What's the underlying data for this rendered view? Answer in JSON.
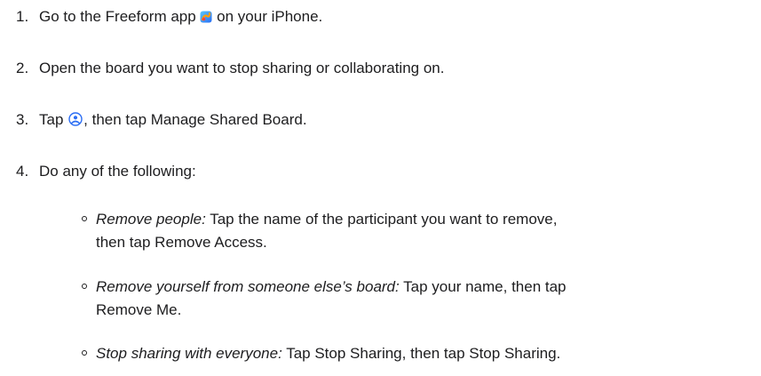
{
  "steps": [
    {
      "num": "1.",
      "before": "Go to the Freeform app",
      "icon": "freeform-app-icon",
      "after": " on your iPhone."
    },
    {
      "num": "2.",
      "text": "Open the board you want to stop sharing or collaborating on."
    },
    {
      "num": "3.",
      "before": "Tap",
      "icon": "collaboration-icon",
      "after": ", then tap Manage Shared Board."
    },
    {
      "num": "4.",
      "text": "Do any of the following:"
    }
  ],
  "options": [
    {
      "label": "Remove people:",
      "line1": " Tap the name of the participant you want to remove,",
      "line2": "then tap Remove Access."
    },
    {
      "label": "Remove yourself from someone else’s board:",
      "line1": " Tap your name, then tap",
      "line2": "Remove Me."
    },
    {
      "label": "Stop sharing with everyone:",
      "line1": " Tap Stop Sharing, then tap Stop Sharing."
    }
  ]
}
